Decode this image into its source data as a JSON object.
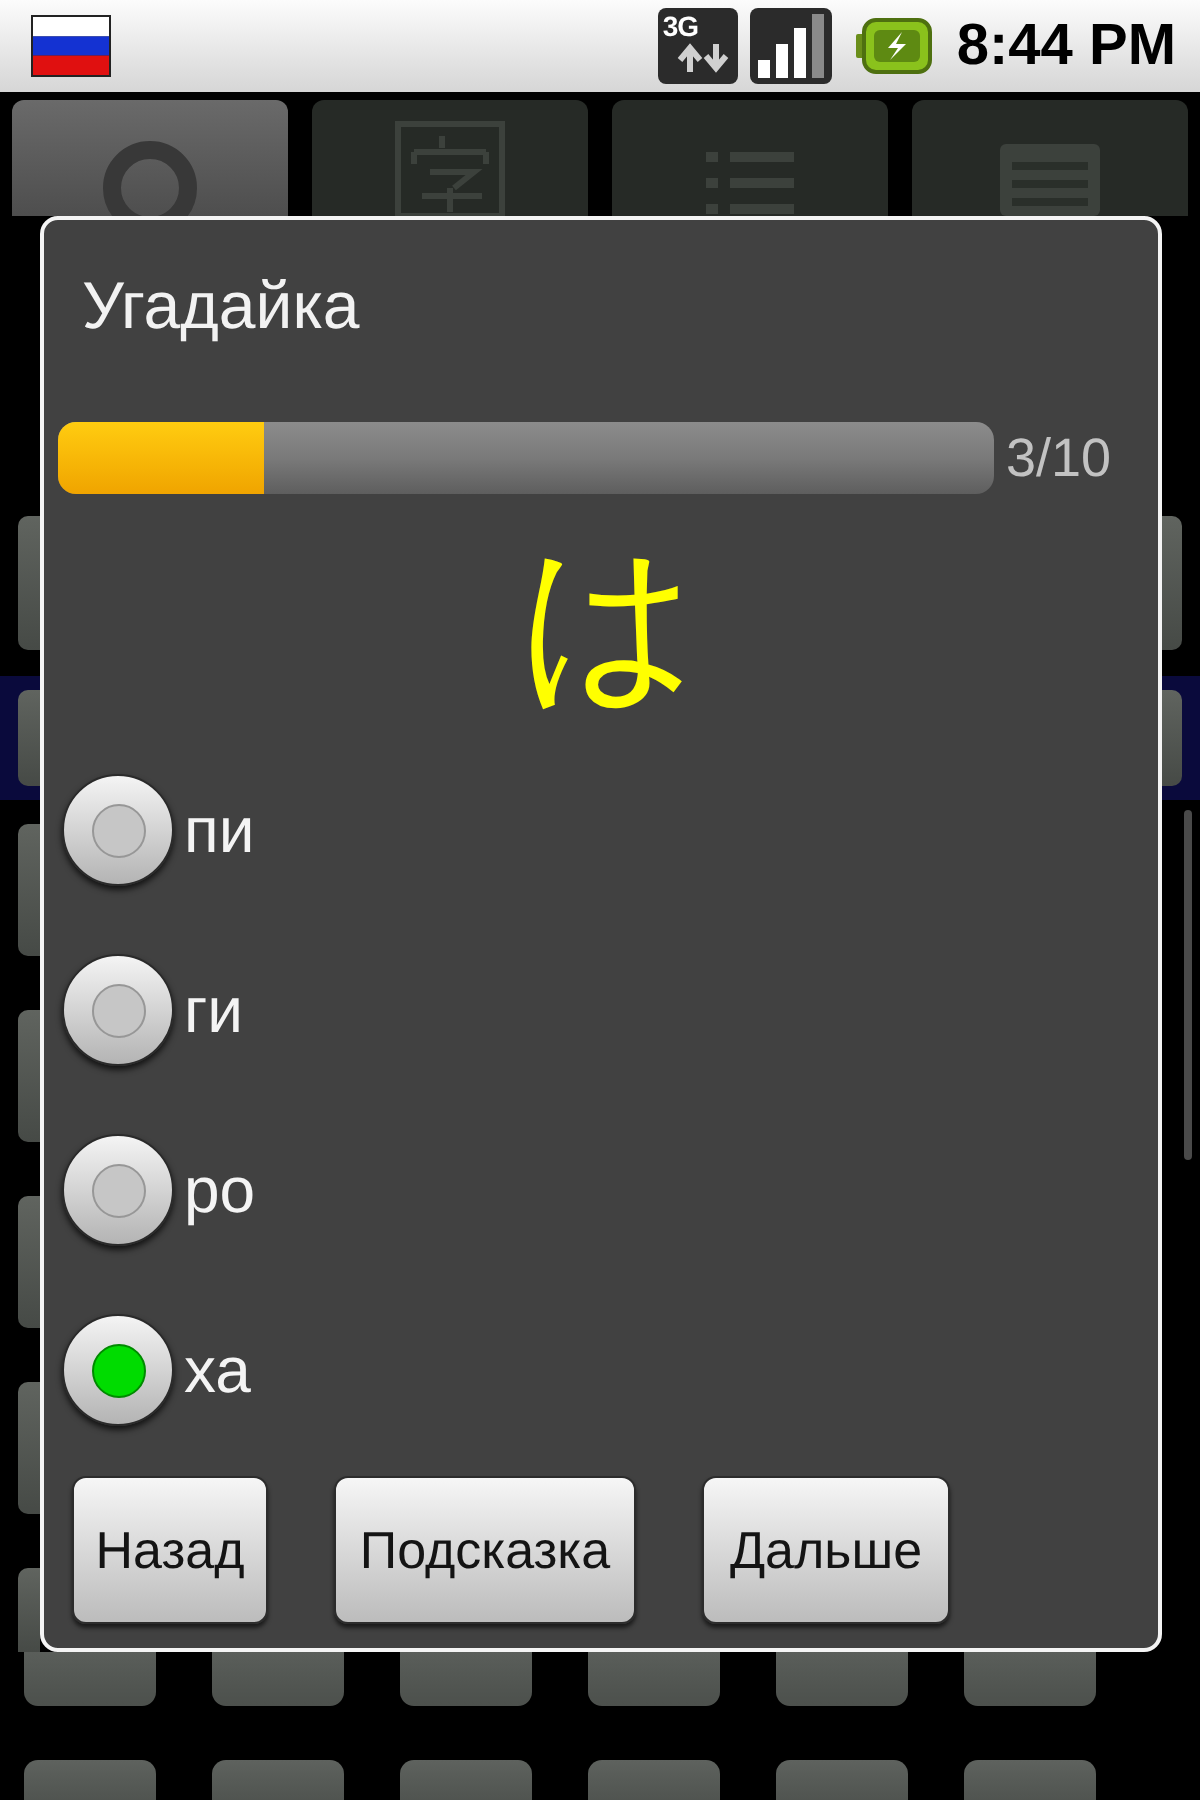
{
  "status_bar": {
    "network": "3G",
    "time": "8:44 PM"
  },
  "tabs": [
    {
      "selected": true
    },
    {
      "selected": false
    },
    {
      "selected": false
    },
    {
      "selected": false
    }
  ],
  "dialog": {
    "title": "Угадайка",
    "progress": {
      "level": 0.22,
      "reading": "3/10"
    },
    "character": "は",
    "options": [
      {
        "label": "пи",
        "selected": false
      },
      {
        "label": "ги",
        "selected": false
      },
      {
        "label": "ро",
        "selected": false
      },
      {
        "label": "ха",
        "selected": true
      }
    ],
    "buttons": [
      "Назад",
      "Подсказка",
      "Дальше"
    ]
  }
}
